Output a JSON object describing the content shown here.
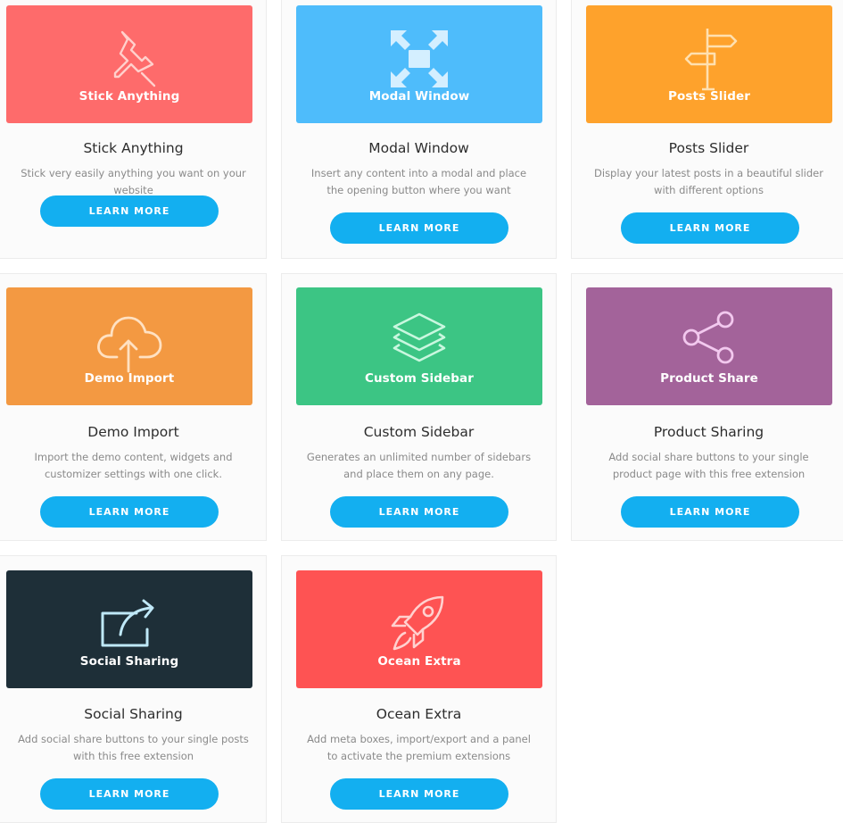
{
  "colors": {
    "stick": "#fe6b6b",
    "modal": "#4ebcfb",
    "posts": "#fea22c",
    "demo": "#f39942",
    "sidebar": "#3cc584",
    "product": "#a3639a",
    "social": "#1e2f38",
    "ocean": "#fe5353",
    "button": "#13aff0"
  },
  "cards": [
    {
      "banner_label": "Stick Anything",
      "title": "Stick Anything",
      "description": "Stick very easily anything you want on your website",
      "button": "LEARN MORE",
      "icon": "pushpin-icon"
    },
    {
      "banner_label": "Modal Window",
      "title": "Modal Window",
      "description": "Insert any content into a modal and place the opening button where you want",
      "button": "LEARN MORE",
      "icon": "expand-arrows-icon"
    },
    {
      "banner_label": "Posts Slider",
      "title": "Posts Slider",
      "description": "Display your latest posts in a beautiful slider with different options",
      "button": "LEARN MORE",
      "icon": "signpost-icon"
    },
    {
      "banner_label": "Demo Import",
      "title": "Demo Import",
      "description": "Import the demo content, widgets and customizer settings with one click.",
      "button": "LEARN MORE",
      "icon": "cloud-upload-icon"
    },
    {
      "banner_label": "Custom Sidebar",
      "title": "Custom Sidebar",
      "description": "Generates an unlimited number of sidebars and place them on any page.",
      "button": "LEARN MORE",
      "icon": "layers-icon"
    },
    {
      "banner_label": "Product Share",
      "title": "Product Sharing",
      "description": "Add social share buttons to your single product page with this free extension",
      "button": "LEARN MORE",
      "icon": "share-nodes-icon"
    },
    {
      "banner_label": "Social Sharing",
      "title": "Social Sharing",
      "description": "Add social share buttons to your single posts with this free extension",
      "button": "LEARN MORE",
      "icon": "share-arrow-icon"
    },
    {
      "banner_label": "Ocean Extra",
      "title": "Ocean Extra",
      "description": "Add meta boxes, import/export and a panel to activate the premium extensions",
      "button": "LEARN MORE",
      "icon": "rocket-icon"
    }
  ]
}
